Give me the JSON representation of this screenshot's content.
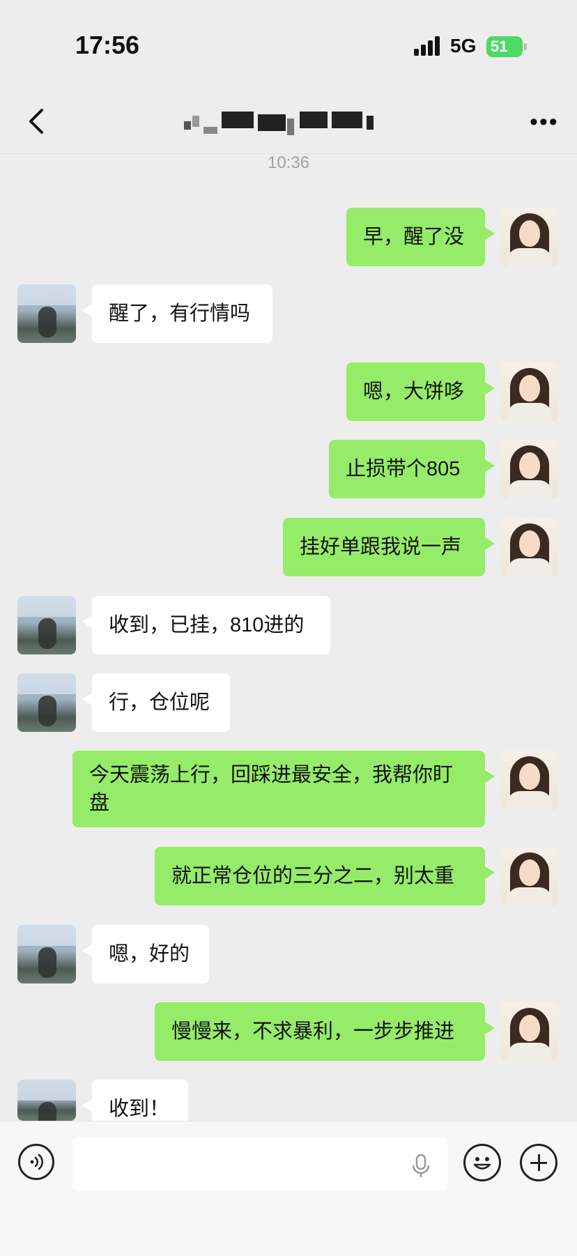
{
  "status": {
    "time": "17:56",
    "network": "5G",
    "battery": "51"
  },
  "header": {
    "title": ""
  },
  "timestamp": "10:36",
  "messages": [
    {
      "side": "out",
      "text": "早，醒了没"
    },
    {
      "side": "in",
      "text": "醒了，有行情吗"
    },
    {
      "side": "out",
      "text": "嗯，大饼哆"
    },
    {
      "side": "out",
      "text": "止损带个805"
    },
    {
      "side": "out",
      "text": "挂好单跟我说一声"
    },
    {
      "side": "in",
      "text": "收到，已挂，810进的"
    },
    {
      "side": "in",
      "text": "行，仓位呢"
    },
    {
      "side": "out",
      "text": "今天震荡上行，回踩进最安全，我帮你盯盘"
    },
    {
      "side": "out",
      "text": "就正常仓位的三分之二，别太重"
    },
    {
      "side": "in",
      "text": "嗯，好的"
    },
    {
      "side": "out",
      "text": "慢慢来，不求暴利，一步步推进"
    },
    {
      "side": "in",
      "text": "收到！"
    }
  ],
  "icons": {
    "back": "chevron-left-icon",
    "more": "more-dots-icon",
    "voice": "voice-icon",
    "mic": "microphone-icon",
    "emoji": "emoji-icon",
    "plus": "plus-icon"
  },
  "colors": {
    "outgoing_bubble": "#95ec69",
    "incoming_bubble": "#ffffff",
    "background": "#ededed"
  }
}
